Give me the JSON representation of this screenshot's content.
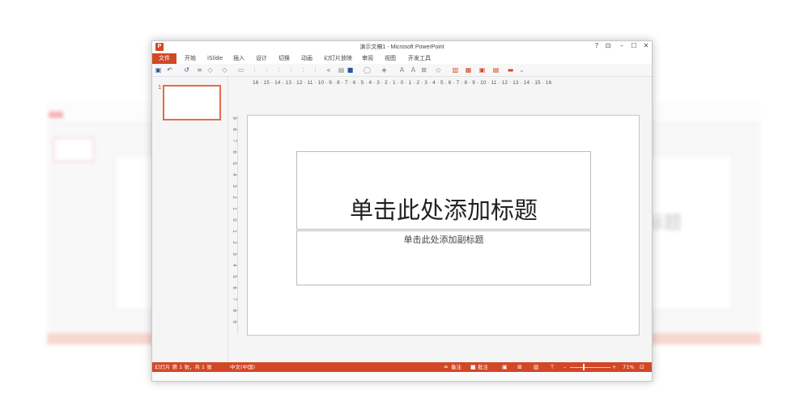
{
  "window": {
    "title": "演示文稿1 - Microsoft PowerPoint",
    "controls": {
      "help": "?",
      "restore_ribbon": "⊡",
      "minimize": "–",
      "maximize": "☐",
      "close": "✕"
    }
  },
  "ribbon_tabs": [
    "文件",
    "开始",
    "iSlide",
    "插入",
    "设计",
    "切换",
    "动画",
    "幻灯片放映",
    "审阅",
    "视图",
    "开发工具"
  ],
  "toolbar_icons": [
    "save-icon",
    "undo-icon",
    "redo-icon",
    "format-icon",
    "shape-icon",
    "picture-icon",
    "align-icon",
    "color-icon",
    "font-size-icon",
    "chart-icon"
  ],
  "ruler": {
    "horizontal": "16 · 15 · 14 · 13 · 12 · 11 · 10 · 9 · 8 · 7 · 6 · 5 · 4 · 3 · 2 · 1 · 0 · 1 · 2 · 3 · 4 · 5 · 6 · 7 · 8 · 9 · 10 · 11 · 12 · 13 · 14 · 15 · 16",
    "vertical": [
      "9",
      "8",
      "7",
      "6",
      "5",
      "4",
      "3",
      "2",
      "1",
      "0",
      "1",
      "2",
      "3",
      "4",
      "5",
      "6",
      "7",
      "8",
      "9"
    ]
  },
  "thumbnails": {
    "slide_number": "1"
  },
  "slide": {
    "title_placeholder": "单击此处添加标题",
    "subtitle_placeholder": "单击此处添加副标题"
  },
  "status": {
    "slide_info": "幻灯片 第 1 张，共 1 张",
    "language": "中文(中国)",
    "notes": "备注",
    "comments": "批注",
    "zoom_minus": "–",
    "zoom_plus": "+",
    "zoom_level": "71%"
  },
  "background_ghost": {
    "text": "标题"
  },
  "colors": {
    "accent": "#d24726"
  }
}
